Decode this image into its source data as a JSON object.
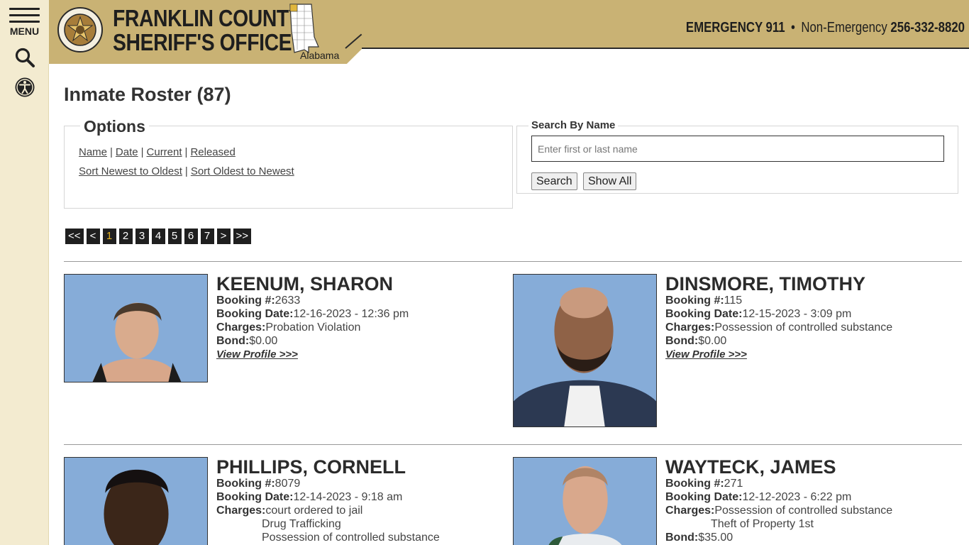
{
  "sidebar": {
    "menu_label": "MENU",
    "search_icon": "search-icon",
    "accessibility_icon": "accessibility-icon"
  },
  "header": {
    "agency_line1": "FRANKLIN COUNTY",
    "agency_line2": "SHERIFF'S OFFICE",
    "state": "Alabama",
    "emergency_label": "EMERGENCY 911",
    "separator": "•",
    "non_emergency_label": "Non-Emergency",
    "non_emergency_phone": "256-332-8820",
    "brand_color": "#c9b274"
  },
  "page": {
    "title": "Inmate Roster (87)"
  },
  "options": {
    "legend": "Options",
    "filters": [
      "Name",
      "Date",
      "Current",
      "Released"
    ],
    "sorts": [
      "Sort Newest to Oldest",
      "Sort Oldest to Newest"
    ],
    "separator": "|"
  },
  "search": {
    "legend": "Search By Name",
    "placeholder": "Enter first or last name",
    "value": "",
    "search_button": "Search",
    "show_all_button": "Show All"
  },
  "pager": {
    "first": "<<",
    "prev": "<",
    "pages": [
      "1",
      "2",
      "3",
      "4",
      "5",
      "6",
      "7"
    ],
    "current": "1",
    "next": ">",
    "last": ">>"
  },
  "labels": {
    "booking_no": "Booking #:",
    "booking_date": "Booking Date:",
    "charges": "Charges:",
    "bond": "Bond:",
    "view_profile": "View Profile >>>"
  },
  "inmates": [
    {
      "name": "KEENUM, SHARON",
      "booking_no": "2633",
      "booking_date": "12-16-2023 - 12:36 pm",
      "charges": [
        "Probation Violation"
      ],
      "bond": "$0.00"
    },
    {
      "name": "DINSMORE, TIMOTHY",
      "booking_no": "115",
      "booking_date": "12-15-2023 - 3:09 pm",
      "charges": [
        "Possession of controlled substance"
      ],
      "bond": "$0.00"
    },
    {
      "name": "PHILLIPS, CORNELL",
      "booking_no": "8079",
      "booking_date": "12-14-2023 - 9:18 am",
      "charges": [
        "court ordered to jail",
        "Drug Trafficking",
        "Possession of controlled substance"
      ]
    },
    {
      "name": "WAYTECK, JAMES",
      "booking_no": "271",
      "booking_date": "12-12-2023 - 6:22 pm",
      "charges": [
        "Possession of controlled substance",
        "Theft of Property 1st"
      ],
      "bond": "$35.00"
    }
  ]
}
